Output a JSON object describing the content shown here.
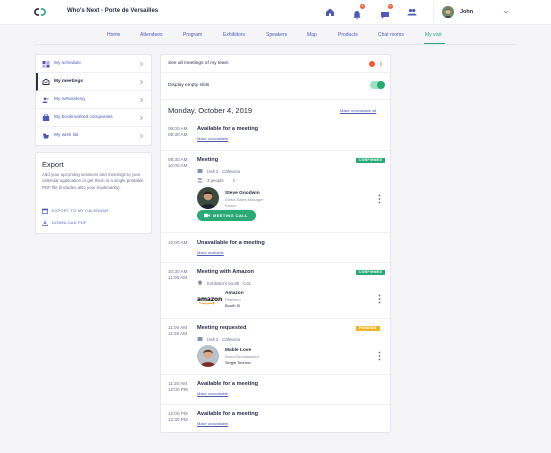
{
  "header": {
    "event_title": "Who's Next - Porte de Versailles",
    "icons": [
      {
        "name": "home-icon",
        "badge": ""
      },
      {
        "name": "bell-icon",
        "badge": "2"
      },
      {
        "name": "chat-icon",
        "badge": "2"
      },
      {
        "name": "people-icon",
        "badge": ""
      }
    ],
    "user_name": "John"
  },
  "nav": {
    "items": [
      {
        "label": "Home"
      },
      {
        "label": "Attendees"
      },
      {
        "label": "Program"
      },
      {
        "label": "Exhibitors"
      },
      {
        "label": "Speakers"
      },
      {
        "label": "Map"
      },
      {
        "label": "Products"
      },
      {
        "label": "Chat rooms"
      },
      {
        "label": "My visit",
        "active": true
      }
    ]
  },
  "sidebar": {
    "items": [
      {
        "label": "My schedule",
        "icon": "schedule-icon"
      },
      {
        "label": "My meetings",
        "icon": "meetings-icon",
        "active": true
      },
      {
        "label": "My networking",
        "icon": "networking-icon"
      },
      {
        "label": "My bookmarked companies",
        "icon": "bookmark-icon"
      },
      {
        "label": "My wish list",
        "icon": "wishlist-icon"
      }
    ]
  },
  "export": {
    "title": "Export",
    "text": "Add your upcoming sessions and meetings to your calendar application or get them in a single printable PDF file (includes also your bookmarks).",
    "calendar_label": "EXPORT TO MY CALENDAR",
    "pdf_label": "DOWNLOAD PDF"
  },
  "meetings": {
    "see_all_label": "See all meetings of my team",
    "empty_slots_label": "Display empty slots",
    "empty_slots_on": true,
    "date_heading": "Monday, October 4, 2019",
    "make_all_unavailable": "Make unavailable all",
    "slots": [
      {
        "start": "09:00 AM",
        "end": "09:30 AM",
        "title": "Available for a meeting",
        "link": "Make unavailable"
      },
      {
        "start": "09:30 AM",
        "end": "10:00 AM",
        "title": "Meeting",
        "status": "CONFIRMED",
        "location": "Hall 3 · Cafeteria",
        "people": "3 people",
        "person_name": "Steve Goodwin",
        "person_role": "Direct Sales Manager",
        "person_company": "Konex",
        "call_label": "MEETING CALL"
      },
      {
        "start": "10:00 AM",
        "end": "",
        "title": "Unavailable for a meeting",
        "link": "Make available"
      },
      {
        "start": "10:30 AM",
        "end": "11:00 AM",
        "title": "Meeting with Amazon",
        "status": "CONFIRMED",
        "location": "Exhibitor's booth · C4L",
        "logo_text": "amazon",
        "company": "Amazon",
        "tier": "Platinum",
        "booth": "Booth I5"
      },
      {
        "start": "11:00 AM",
        "end": "11:30 AM",
        "title": "Meeting requested",
        "status": "PENDING",
        "location": "Hall 3 · Cafeteria",
        "person_name": "Mable Love",
        "person_role": "Brand Ambassador",
        "person_company": "Single Technic"
      },
      {
        "start": "11:30 AM",
        "end": "12:00 PM",
        "title": "Available for a meeting",
        "link": "Make unavailable"
      },
      {
        "start": "12:00 PM",
        "end": "12:30 PM",
        "title": "Available for a meeting",
        "link": "Make unavailable"
      }
    ]
  },
  "colors": {
    "accent_green": "#2aa876",
    "link_blue": "#4d5bb3",
    "pending_yellow": "#f0b429",
    "notification_orange": "#f05a3b"
  }
}
